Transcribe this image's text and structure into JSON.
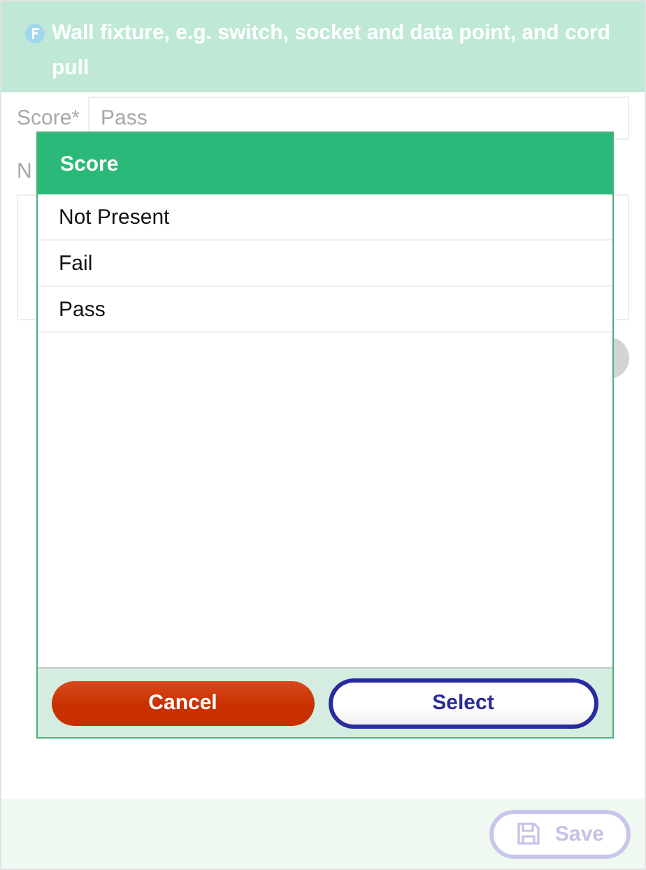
{
  "header": {
    "title": "Wall fixture, e.g. switch, socket and data point, and cord pull"
  },
  "form": {
    "score_label": "Score*",
    "score_value": "Pass",
    "notes_label": "N"
  },
  "dialog": {
    "title": "Score",
    "options": [
      {
        "label": "Not Present"
      },
      {
        "label": "Fail"
      },
      {
        "label": "Pass"
      }
    ],
    "cancel": "Cancel",
    "select": "Select"
  },
  "footer": {
    "save": {
      "label": "Save",
      "disabled": true
    }
  }
}
